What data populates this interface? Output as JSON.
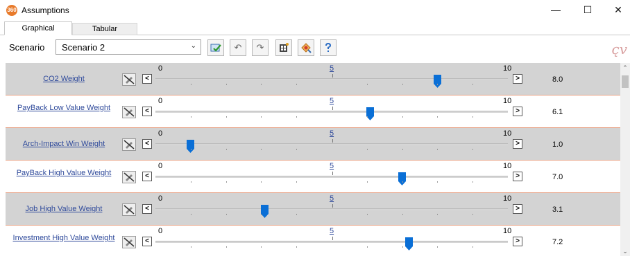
{
  "window": {
    "title": "Assumptions",
    "app_icon_text": "360",
    "minimize": "—",
    "maximize": "☐",
    "close": "✕"
  },
  "tabs": [
    {
      "label": "Graphical",
      "active": true
    },
    {
      "label": "Tabular",
      "active": false
    }
  ],
  "toolbar": {
    "scenario_label": "Scenario",
    "scenario_value": "Scenario 2",
    "buttons": [
      "apply-check-icon",
      "undo-icon",
      "redo-icon",
      "grid-calc-icon",
      "palette-icon",
      "help-icon"
    ],
    "logo_text": "c̨v"
  },
  "slider_scale": {
    "min": "0",
    "mid": "5",
    "max": "10",
    "min_value": 0,
    "max_value": 10
  },
  "rows": [
    {
      "label": "CO2 Weight",
      "value": "8.0",
      "level": 8.0,
      "shade": true
    },
    {
      "label": "PayBack  Low Value Weight",
      "value": "6.1",
      "level": 6.1,
      "shade": false
    },
    {
      "label": "Arch-Impact  Win Weight",
      "value": "1.0",
      "level": 1.0,
      "shade": true
    },
    {
      "label": "PayBack  High Value Weight",
      "value": "7.0",
      "level": 7.0,
      "shade": false
    },
    {
      "label": "Job  High Value Weight",
      "value": "3.1",
      "level": 3.1,
      "shade": true
    },
    {
      "label": "Investment  High Value Weight",
      "value": "7.2",
      "level": 7.2,
      "shade": false
    }
  ],
  "colors": {
    "thumb": "#0a6fd6",
    "link": "#2f4a9b",
    "row_shade": "#d3d3d3",
    "row_divider": "#e8a082"
  }
}
